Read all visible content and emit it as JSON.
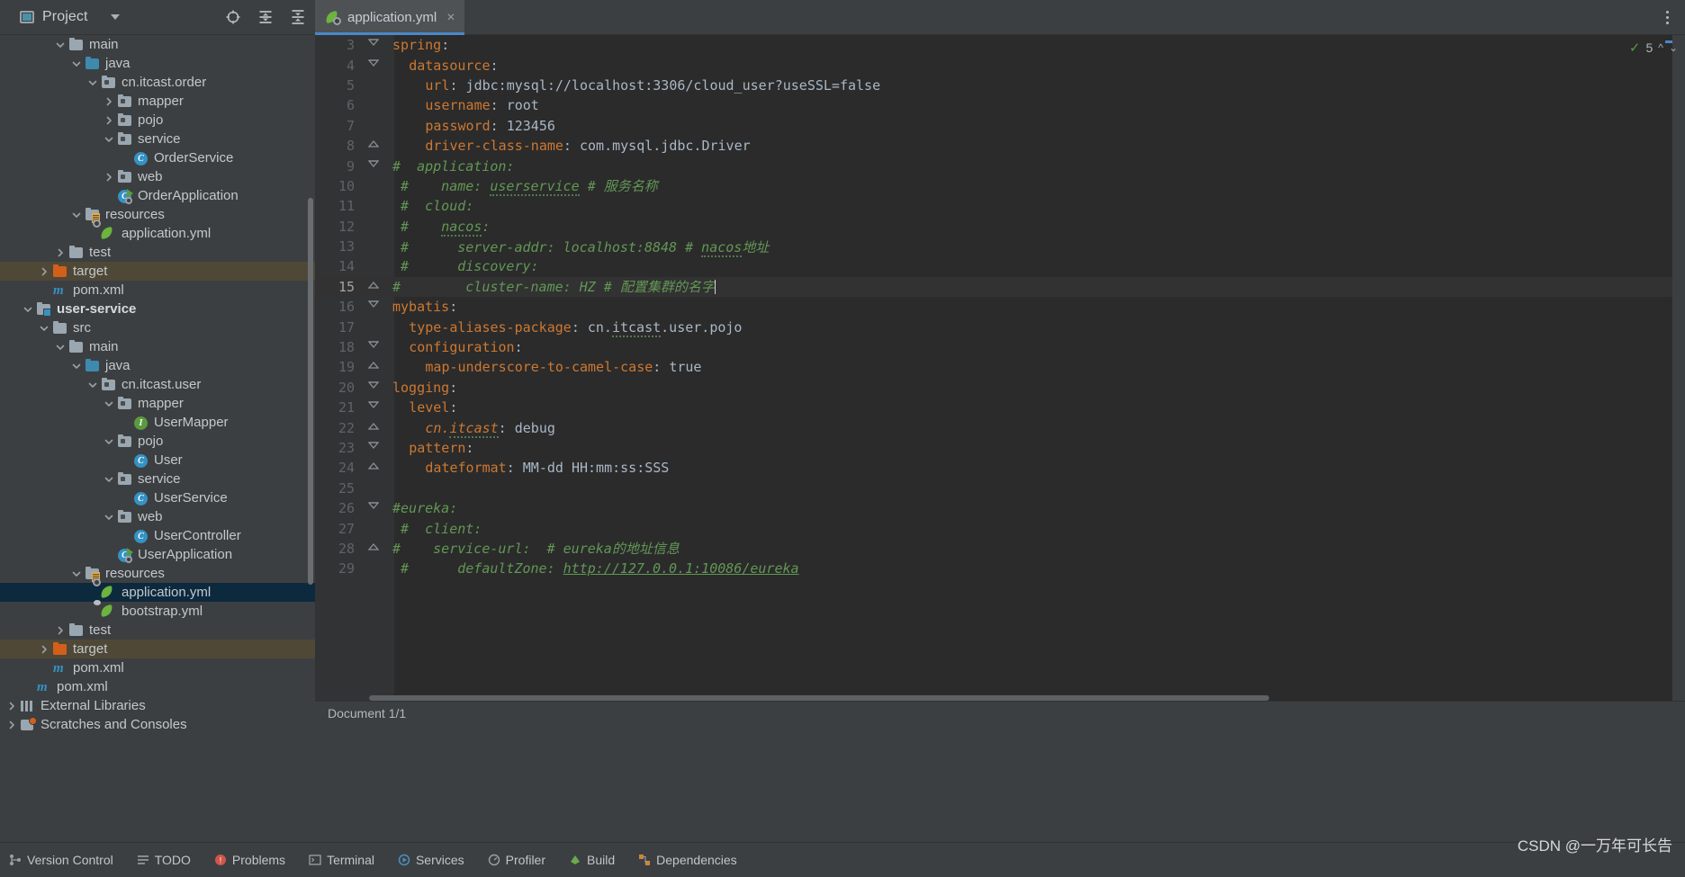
{
  "window": {
    "project_panel_title": "Project",
    "toolbar_icons": [
      "locate-icon",
      "expand-all-icon",
      "collapse-all-icon",
      "settings-gear-icon",
      "hide-panel-icon"
    ],
    "menu_icon": "kebab-menu-icon"
  },
  "tabs": [
    {
      "label": "application.yml",
      "icon": "yaml-file-icon",
      "active": true,
      "close": "×"
    }
  ],
  "sidebar": {
    "scrollbar": "vertical-scrollbar",
    "items": [
      {
        "label": "main",
        "indent": 3,
        "arrow": "down",
        "icon": "folder-gray"
      },
      {
        "label": "java",
        "indent": 4,
        "arrow": "down",
        "icon": "folder-blue"
      },
      {
        "label": "cn.itcast.order",
        "indent": 5,
        "arrow": "down",
        "icon": "folder-package"
      },
      {
        "label": "mapper",
        "indent": 6,
        "arrow": "right",
        "icon": "folder-package"
      },
      {
        "label": "pojo",
        "indent": 6,
        "arrow": "right",
        "icon": "folder-package"
      },
      {
        "label": "service",
        "indent": 6,
        "arrow": "down",
        "icon": "folder-package"
      },
      {
        "label": "OrderService",
        "indent": 7,
        "arrow": "none",
        "icon": "class-icon"
      },
      {
        "label": "web",
        "indent": 6,
        "arrow": "right",
        "icon": "folder-package"
      },
      {
        "label": "OrderApplication",
        "indent": 6,
        "arrow": "none",
        "icon": "spring-boot-class-icon"
      },
      {
        "label": "resources",
        "indent": 4,
        "arrow": "down",
        "icon": "folder-resources"
      },
      {
        "label": "application.yml",
        "indent": 5,
        "arrow": "none",
        "icon": "yaml-file-icon"
      },
      {
        "label": "test",
        "indent": 3,
        "arrow": "right",
        "icon": "folder-gray"
      },
      {
        "label": "target",
        "indent": 2,
        "arrow": "right",
        "icon": "folder-orange",
        "highlight": "target"
      },
      {
        "label": "pom.xml",
        "indent": 2,
        "arrow": "none",
        "icon": "maven-icon"
      },
      {
        "label": "user-service",
        "indent": 1,
        "arrow": "down",
        "icon": "folder-module",
        "bold": true
      },
      {
        "label": "src",
        "indent": 2,
        "arrow": "down",
        "icon": "folder-gray"
      },
      {
        "label": "main",
        "indent": 3,
        "arrow": "down",
        "icon": "folder-gray"
      },
      {
        "label": "java",
        "indent": 4,
        "arrow": "down",
        "icon": "folder-blue"
      },
      {
        "label": "cn.itcast.user",
        "indent": 5,
        "arrow": "down",
        "icon": "folder-package"
      },
      {
        "label": "mapper",
        "indent": 6,
        "arrow": "down",
        "icon": "folder-package"
      },
      {
        "label": "UserMapper",
        "indent": 7,
        "arrow": "none",
        "icon": "interface-icon"
      },
      {
        "label": "pojo",
        "indent": 6,
        "arrow": "down",
        "icon": "folder-package"
      },
      {
        "label": "User",
        "indent": 7,
        "arrow": "none",
        "icon": "class-icon"
      },
      {
        "label": "service",
        "indent": 6,
        "arrow": "down",
        "icon": "folder-package"
      },
      {
        "label": "UserService",
        "indent": 7,
        "arrow": "none",
        "icon": "class-icon"
      },
      {
        "label": "web",
        "indent": 6,
        "arrow": "down",
        "icon": "folder-package"
      },
      {
        "label": "UserController",
        "indent": 7,
        "arrow": "none",
        "icon": "class-icon"
      },
      {
        "label": "UserApplication",
        "indent": 6,
        "arrow": "none",
        "icon": "spring-boot-class-icon"
      },
      {
        "label": "resources",
        "indent": 4,
        "arrow": "down",
        "icon": "folder-resources"
      },
      {
        "label": "application.yml",
        "indent": 5,
        "arrow": "none",
        "icon": "yaml-file-icon",
        "selected": true
      },
      {
        "label": "bootstrap.yml",
        "indent": 5,
        "arrow": "none",
        "icon": "yaml-plain-icon"
      },
      {
        "label": "test",
        "indent": 3,
        "arrow": "right",
        "icon": "folder-gray"
      },
      {
        "label": "target",
        "indent": 2,
        "arrow": "right",
        "icon": "folder-orange",
        "highlight": "target"
      },
      {
        "label": "pom.xml",
        "indent": 2,
        "arrow": "none",
        "icon": "maven-icon"
      },
      {
        "label": "pom.xml",
        "indent": 1,
        "arrow": "none",
        "icon": "maven-icon"
      },
      {
        "label": "External Libraries",
        "indent": 0,
        "arrow": "right",
        "icon": "libraries-icon"
      },
      {
        "label": "Scratches and Consoles",
        "indent": 0,
        "arrow": "right",
        "icon": "scratches-icon"
      }
    ]
  },
  "editor": {
    "inspection": {
      "count": "5",
      "check_icon": "inspection-ok-icon",
      "up": "⌃",
      "down": "⌄"
    },
    "lines": [
      {
        "n": "3",
        "fold": "open",
        "segs": [
          {
            "t": "spring",
            "c": "k"
          },
          {
            "t": ":",
            "c": "v"
          }
        ]
      },
      {
        "n": "4",
        "fold": "open",
        "indent": 2,
        "segs": [
          {
            "t": "datasource",
            "c": "k"
          },
          {
            "t": ":",
            "c": "v"
          }
        ]
      },
      {
        "n": "5",
        "fold": "none",
        "indent": 4,
        "segs": [
          {
            "t": "url",
            "c": "k"
          },
          {
            "t": ": ",
            "c": "v"
          },
          {
            "t": "jdbc:mysql://localhost:3306/cloud_user?useSSL=false",
            "c": "v"
          }
        ]
      },
      {
        "n": "6",
        "fold": "none",
        "indent": 4,
        "segs": [
          {
            "t": "username",
            "c": "k"
          },
          {
            "t": ": ",
            "c": "v"
          },
          {
            "t": "root",
            "c": "v"
          }
        ]
      },
      {
        "n": "7",
        "fold": "none",
        "indent": 4,
        "segs": [
          {
            "t": "password",
            "c": "k"
          },
          {
            "t": ": ",
            "c": "v"
          },
          {
            "t": "123456",
            "c": "num"
          }
        ]
      },
      {
        "n": "8",
        "fold": "close",
        "indent": 4,
        "segs": [
          {
            "t": "driver-class-name",
            "c": "k"
          },
          {
            "t": ": ",
            "c": "v"
          },
          {
            "t": "com.mysql.jdbc.Driver",
            "c": "v"
          }
        ]
      },
      {
        "n": "9",
        "fold": "open",
        "indent": 0,
        "segs": [
          {
            "t": "#  application:",
            "c": "cmt"
          }
        ]
      },
      {
        "n": "10",
        "fold": "none",
        "indent": 0,
        "segs": [
          {
            "t": " #    name: ",
            "c": "cmt"
          },
          {
            "t": "userservice",
            "c": "cmt sq"
          },
          {
            "t": " # 服务名称",
            "c": "cmt"
          }
        ]
      },
      {
        "n": "11",
        "fold": "none",
        "indent": 0,
        "segs": [
          {
            "t": " #  cloud:",
            "c": "cmt"
          }
        ]
      },
      {
        "n": "12",
        "fold": "none",
        "indent": 0,
        "segs": [
          {
            "t": " #    ",
            "c": "cmt"
          },
          {
            "t": "nacos",
            "c": "cmt sq"
          },
          {
            "t": ":",
            "c": "cmt"
          }
        ]
      },
      {
        "n": "13",
        "fold": "none",
        "indent": 0,
        "segs": [
          {
            "t": " #      server-addr: localhost:8848 # ",
            "c": "cmt"
          },
          {
            "t": "nacos",
            "c": "cmt sq"
          },
          {
            "t": "地址",
            "c": "cmt"
          }
        ]
      },
      {
        "n": "14",
        "fold": "none",
        "indent": 0,
        "segs": [
          {
            "t": " #      discovery:",
            "c": "cmt"
          }
        ]
      },
      {
        "n": "15",
        "fold": "close",
        "indent": 0,
        "current": true,
        "caret": true,
        "segs": [
          {
            "t": "#        cluster-name: HZ # 配置集群的名字",
            "c": "cmt"
          }
        ]
      },
      {
        "n": "16",
        "fold": "open",
        "indent": 0,
        "segs": [
          {
            "t": "mybatis",
            "c": "k"
          },
          {
            "t": ":",
            "c": "v"
          }
        ]
      },
      {
        "n": "17",
        "fold": "none",
        "indent": 2,
        "segs": [
          {
            "t": "type-aliases-package",
            "c": "k"
          },
          {
            "t": ": ",
            "c": "v"
          },
          {
            "t": "cn.",
            "c": "v"
          },
          {
            "t": "itcast",
            "c": "v sq"
          },
          {
            "t": ".user.pojo",
            "c": "v"
          }
        ]
      },
      {
        "n": "18",
        "fold": "open",
        "indent": 2,
        "segs": [
          {
            "t": "configuration",
            "c": "k"
          },
          {
            "t": ":",
            "c": "v"
          }
        ]
      },
      {
        "n": "19",
        "fold": "close",
        "indent": 4,
        "segs": [
          {
            "t": "map-underscore-to-camel-case",
            "c": "k"
          },
          {
            "t": ": ",
            "c": "v"
          },
          {
            "t": "true",
            "c": "v"
          }
        ]
      },
      {
        "n": "20",
        "fold": "open",
        "indent": 0,
        "segs": [
          {
            "t": "logging",
            "c": "k"
          },
          {
            "t": ":",
            "c": "v"
          }
        ]
      },
      {
        "n": "21",
        "fold": "open",
        "indent": 2,
        "segs": [
          {
            "t": "level",
            "c": "k"
          },
          {
            "t": ":",
            "c": "v"
          }
        ]
      },
      {
        "n": "22",
        "fold": "close",
        "indent": 4,
        "segs": [
          {
            "t": "cn.",
            "c": "ki"
          },
          {
            "t": "itcast",
            "c": "ki sq"
          },
          {
            "t": ": ",
            "c": "v"
          },
          {
            "t": "debug",
            "c": "v"
          }
        ]
      },
      {
        "n": "23",
        "fold": "open",
        "indent": 2,
        "segs": [
          {
            "t": "pattern",
            "c": "k"
          },
          {
            "t": ":",
            "c": "v"
          }
        ]
      },
      {
        "n": "24",
        "fold": "close",
        "indent": 4,
        "segs": [
          {
            "t": "dateformat",
            "c": "k"
          },
          {
            "t": ": ",
            "c": "v"
          },
          {
            "t": "MM-dd HH:mm:ss:SSS",
            "c": "v"
          }
        ]
      },
      {
        "n": "25",
        "fold": "none",
        "indent": 0,
        "segs": []
      },
      {
        "n": "26",
        "fold": "open",
        "indent": 0,
        "segs": [
          {
            "t": "#eureka:",
            "c": "cmt"
          }
        ]
      },
      {
        "n": "27",
        "fold": "none",
        "indent": 0,
        "segs": [
          {
            "t": " #  client:",
            "c": "cmt"
          }
        ]
      },
      {
        "n": "28",
        "fold": "close",
        "indent": 0,
        "segs": [
          {
            "t": "#    service-url:  # eureka的地址信息",
            "c": "cmt"
          }
        ]
      },
      {
        "n": "29",
        "fold": "none",
        "indent": 0,
        "segs": [
          {
            "t": " #      defaultZone: ",
            "c": "cmt"
          },
          {
            "t": "http://127.0.0.1:10086/eureka",
            "c": "lnk"
          }
        ]
      }
    ]
  },
  "status": {
    "document": "Document 1/1"
  },
  "bottom_bar": {
    "items": [
      {
        "label": "Version Control",
        "icon": "version-control-icon"
      },
      {
        "label": "TODO",
        "icon": "todo-icon"
      },
      {
        "label": "Problems",
        "icon": "problems-icon"
      },
      {
        "label": "Terminal",
        "icon": "terminal-icon"
      },
      {
        "label": "Services",
        "icon": "services-icon"
      },
      {
        "label": "Profiler",
        "icon": "profiler-icon"
      },
      {
        "label": "Build",
        "icon": "build-icon"
      },
      {
        "label": "Dependencies",
        "icon": "dependencies-icon"
      }
    ]
  },
  "watermark": "CSDN @一万年可长告",
  "colors": {
    "accent": "#4a88c7",
    "selection": "#0d293e",
    "target_highlight": "#4f4836",
    "editor_bg": "#2b2b2b",
    "panel_bg": "#3c3f41",
    "key": "#cc7832",
    "comment": "#629755",
    "value": "#a9b7c6"
  }
}
